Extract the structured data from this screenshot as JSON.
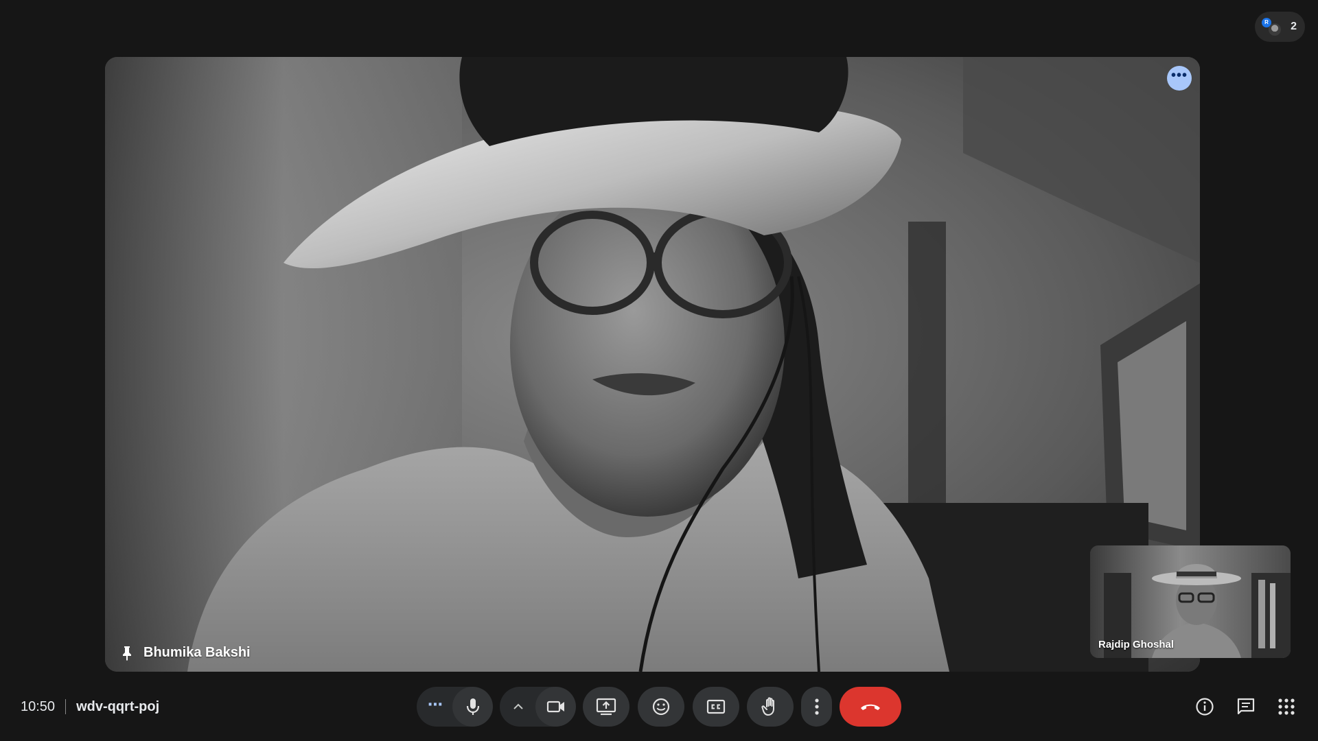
{
  "header": {
    "participant_count": "2",
    "avatar_initial": "R"
  },
  "main_tile": {
    "participant_name": "Bhumika Bakshi",
    "menu_label": "•••"
  },
  "self_tile": {
    "participant_name": "Rajdip Ghoshal"
  },
  "meeting": {
    "time": "10:50",
    "code": "wdv-qqrt-poj"
  },
  "controls": {
    "audio_options_label": "⋯",
    "video_options_label": "^"
  },
  "icons": {
    "pin": "pin-icon",
    "mic": "mic-icon",
    "camera": "camera-icon",
    "present": "present-screen-icon",
    "emoji": "emoji-icon",
    "captions": "captions-icon",
    "raise_hand": "raise-hand-icon",
    "more": "more-vert-icon",
    "end_call": "end-call-icon",
    "info": "info-icon",
    "chat": "chat-icon",
    "activities": "apps-grid-icon"
  },
  "colors": {
    "background": "#161616",
    "control": "#333537",
    "end_call": "#dc362e",
    "accent_blue": "#a8c7fa"
  }
}
